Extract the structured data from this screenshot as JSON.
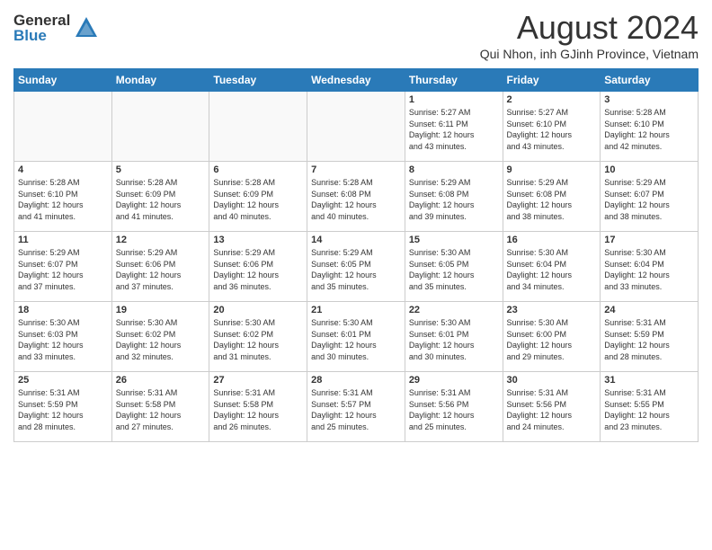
{
  "header": {
    "logo_general": "General",
    "logo_blue": "Blue",
    "month_year": "August 2024",
    "location": "Qui Nhon, inh GJinh Province, Vietnam"
  },
  "weekdays": [
    "Sunday",
    "Monday",
    "Tuesday",
    "Wednesday",
    "Thursday",
    "Friday",
    "Saturday"
  ],
  "weeks": [
    [
      {
        "day": "",
        "info": ""
      },
      {
        "day": "",
        "info": ""
      },
      {
        "day": "",
        "info": ""
      },
      {
        "day": "",
        "info": ""
      },
      {
        "day": "1",
        "info": "Sunrise: 5:27 AM\nSunset: 6:11 PM\nDaylight: 12 hours\nand 43 minutes."
      },
      {
        "day": "2",
        "info": "Sunrise: 5:27 AM\nSunset: 6:10 PM\nDaylight: 12 hours\nand 43 minutes."
      },
      {
        "day": "3",
        "info": "Sunrise: 5:28 AM\nSunset: 6:10 PM\nDaylight: 12 hours\nand 42 minutes."
      }
    ],
    [
      {
        "day": "4",
        "info": "Sunrise: 5:28 AM\nSunset: 6:10 PM\nDaylight: 12 hours\nand 41 minutes."
      },
      {
        "day": "5",
        "info": "Sunrise: 5:28 AM\nSunset: 6:09 PM\nDaylight: 12 hours\nand 41 minutes."
      },
      {
        "day": "6",
        "info": "Sunrise: 5:28 AM\nSunset: 6:09 PM\nDaylight: 12 hours\nand 40 minutes."
      },
      {
        "day": "7",
        "info": "Sunrise: 5:28 AM\nSunset: 6:08 PM\nDaylight: 12 hours\nand 40 minutes."
      },
      {
        "day": "8",
        "info": "Sunrise: 5:29 AM\nSunset: 6:08 PM\nDaylight: 12 hours\nand 39 minutes."
      },
      {
        "day": "9",
        "info": "Sunrise: 5:29 AM\nSunset: 6:08 PM\nDaylight: 12 hours\nand 38 minutes."
      },
      {
        "day": "10",
        "info": "Sunrise: 5:29 AM\nSunset: 6:07 PM\nDaylight: 12 hours\nand 38 minutes."
      }
    ],
    [
      {
        "day": "11",
        "info": "Sunrise: 5:29 AM\nSunset: 6:07 PM\nDaylight: 12 hours\nand 37 minutes."
      },
      {
        "day": "12",
        "info": "Sunrise: 5:29 AM\nSunset: 6:06 PM\nDaylight: 12 hours\nand 37 minutes."
      },
      {
        "day": "13",
        "info": "Sunrise: 5:29 AM\nSunset: 6:06 PM\nDaylight: 12 hours\nand 36 minutes."
      },
      {
        "day": "14",
        "info": "Sunrise: 5:29 AM\nSunset: 6:05 PM\nDaylight: 12 hours\nand 35 minutes."
      },
      {
        "day": "15",
        "info": "Sunrise: 5:30 AM\nSunset: 6:05 PM\nDaylight: 12 hours\nand 35 minutes."
      },
      {
        "day": "16",
        "info": "Sunrise: 5:30 AM\nSunset: 6:04 PM\nDaylight: 12 hours\nand 34 minutes."
      },
      {
        "day": "17",
        "info": "Sunrise: 5:30 AM\nSunset: 6:04 PM\nDaylight: 12 hours\nand 33 minutes."
      }
    ],
    [
      {
        "day": "18",
        "info": "Sunrise: 5:30 AM\nSunset: 6:03 PM\nDaylight: 12 hours\nand 33 minutes."
      },
      {
        "day": "19",
        "info": "Sunrise: 5:30 AM\nSunset: 6:02 PM\nDaylight: 12 hours\nand 32 minutes."
      },
      {
        "day": "20",
        "info": "Sunrise: 5:30 AM\nSunset: 6:02 PM\nDaylight: 12 hours\nand 31 minutes."
      },
      {
        "day": "21",
        "info": "Sunrise: 5:30 AM\nSunset: 6:01 PM\nDaylight: 12 hours\nand 30 minutes."
      },
      {
        "day": "22",
        "info": "Sunrise: 5:30 AM\nSunset: 6:01 PM\nDaylight: 12 hours\nand 30 minutes."
      },
      {
        "day": "23",
        "info": "Sunrise: 5:30 AM\nSunset: 6:00 PM\nDaylight: 12 hours\nand 29 minutes."
      },
      {
        "day": "24",
        "info": "Sunrise: 5:31 AM\nSunset: 5:59 PM\nDaylight: 12 hours\nand 28 minutes."
      }
    ],
    [
      {
        "day": "25",
        "info": "Sunrise: 5:31 AM\nSunset: 5:59 PM\nDaylight: 12 hours\nand 28 minutes."
      },
      {
        "day": "26",
        "info": "Sunrise: 5:31 AM\nSunset: 5:58 PM\nDaylight: 12 hours\nand 27 minutes."
      },
      {
        "day": "27",
        "info": "Sunrise: 5:31 AM\nSunset: 5:58 PM\nDaylight: 12 hours\nand 26 minutes."
      },
      {
        "day": "28",
        "info": "Sunrise: 5:31 AM\nSunset: 5:57 PM\nDaylight: 12 hours\nand 25 minutes."
      },
      {
        "day": "29",
        "info": "Sunrise: 5:31 AM\nSunset: 5:56 PM\nDaylight: 12 hours\nand 25 minutes."
      },
      {
        "day": "30",
        "info": "Sunrise: 5:31 AM\nSunset: 5:56 PM\nDaylight: 12 hours\nand 24 minutes."
      },
      {
        "day": "31",
        "info": "Sunrise: 5:31 AM\nSunset: 5:55 PM\nDaylight: 12 hours\nand 23 minutes."
      }
    ]
  ]
}
